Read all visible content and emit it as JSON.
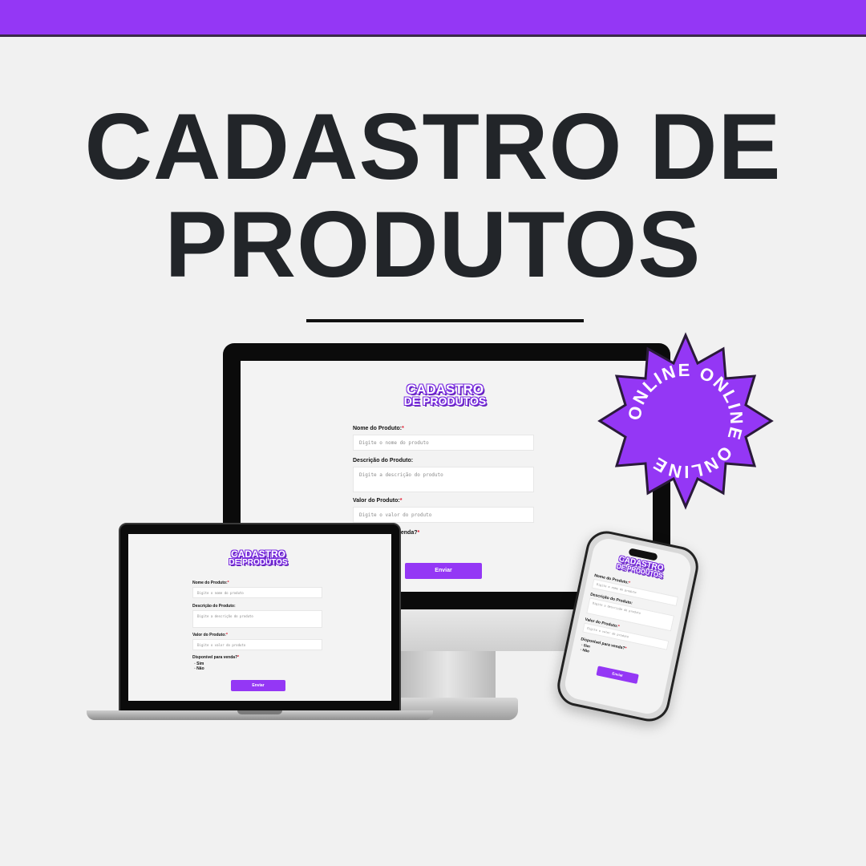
{
  "header": {
    "title_line1": "CADASTRO DE",
    "title_line2": "PRODUTOS"
  },
  "badge": {
    "text": "ONLINE ONLINE ONLINE",
    "color": "#9437f5"
  },
  "form": {
    "logo_line1": "CADASTRO",
    "logo_line2": "DE PRODUTOS",
    "name_label": "Nome do Produto:",
    "name_placeholder": "Digite o nome do produto",
    "desc_label": "Descrição do Produto:",
    "desc_placeholder": "Digite a descrição do produto",
    "value_label": "Valor do Produto:",
    "value_placeholder": "Digite o valor do produto",
    "available_label": "Disponível para venda?",
    "available_label_visible_monitor": "venda?",
    "required_mark": "*",
    "option_yes": "Sim",
    "option_no": "Não",
    "submit_label": "Enviar"
  },
  "colors": {
    "accent": "#9437f5",
    "text_dark": "#222529",
    "required": "#e0162b",
    "background": "#f1f1f1"
  }
}
